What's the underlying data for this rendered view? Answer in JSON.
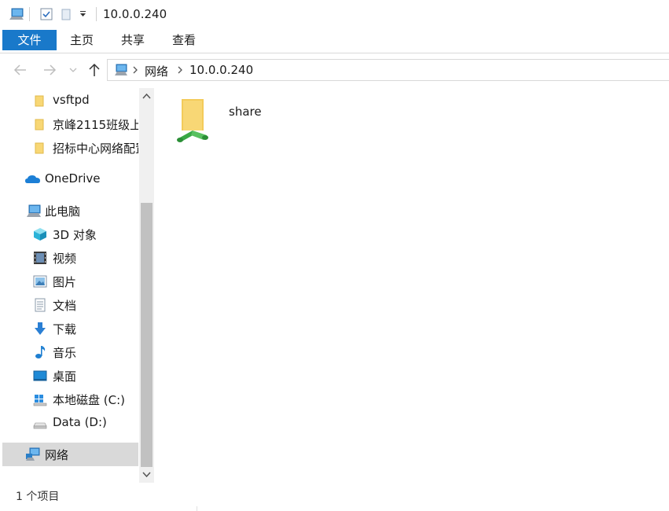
{
  "window": {
    "title": "10.0.0.240"
  },
  "ribbon": {
    "tabs": [
      "文件",
      "主页",
      "共享",
      "查看"
    ]
  },
  "address": {
    "crumbs": [
      "网络",
      "10.0.0.240"
    ]
  },
  "sidebar": {
    "items": [
      {
        "label": "vsftpd",
        "icon": "folder-icon"
      },
      {
        "label": "京峰2115班级上",
        "icon": "folder-icon"
      },
      {
        "label": "招标中心网络配置",
        "icon": "folder-icon"
      },
      {
        "label": "OneDrive",
        "icon": "onedrive-icon"
      },
      {
        "label": "此电脑",
        "icon": "this-pc-icon"
      },
      {
        "label": "3D 对象",
        "icon": "3d-objects-icon"
      },
      {
        "label": "视频",
        "icon": "videos-icon"
      },
      {
        "label": "图片",
        "icon": "pictures-icon"
      },
      {
        "label": "文档",
        "icon": "documents-icon"
      },
      {
        "label": "下载",
        "icon": "downloads-icon"
      },
      {
        "label": "音乐",
        "icon": "music-icon"
      },
      {
        "label": "桌面",
        "icon": "desktop-icon"
      },
      {
        "label": "本地磁盘 (C:)",
        "icon": "local-disk-icon"
      },
      {
        "label": "Data (D:)",
        "icon": "drive-icon"
      },
      {
        "label": "网络",
        "icon": "network-icon",
        "selected": true
      }
    ]
  },
  "content": {
    "items": [
      {
        "label": "share",
        "icon": "shared-folder-icon"
      }
    ]
  },
  "status": {
    "count_text": "1 个项目"
  },
  "colors": {
    "accent": "#1979ca",
    "selected_bg": "#d9d9d9",
    "folder": "#f8d775"
  }
}
